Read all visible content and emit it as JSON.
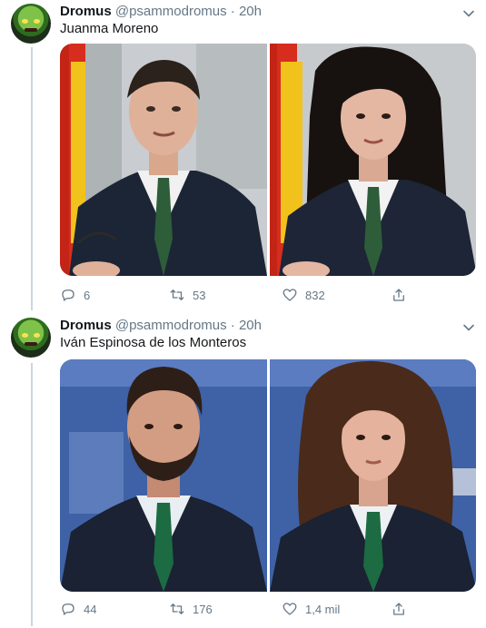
{
  "tweets": [
    {
      "author": {
        "name": "Dromus",
        "handle": "@psammodromus"
      },
      "separator": "·",
      "time": "20h",
      "text": "Juanma Moreno",
      "stats": {
        "replies": "6",
        "retweets": "53",
        "likes": "832"
      },
      "photos": [
        {
          "subject": "man-suit-green-tie-spanish-flag"
        },
        {
          "subject": "woman-suit-green-tie-spanish-flag"
        }
      ]
    },
    {
      "author": {
        "name": "Dromus",
        "handle": "@psammodromus"
      },
      "separator": "·",
      "time": "20h",
      "text": "Iván Espinosa de los Monteros",
      "stats": {
        "replies": "44",
        "retweets": "176",
        "likes": "1,4 mil"
      },
      "photos": [
        {
          "subject": "bearded-man-suit-green-tie-blue-backdrop"
        },
        {
          "subject": "curly-hair-woman-suit-green-tie-blue-backdrop"
        }
      ]
    }
  ],
  "icons": {
    "reply": "reply-icon",
    "retweet": "retweet-icon",
    "like": "heart-icon",
    "share": "share-icon",
    "menu": "chevron-down-icon"
  },
  "colors": {
    "secondary_text": "#657786",
    "thread_line": "#ccd6dd",
    "tie_green": "#2e5d3a"
  }
}
